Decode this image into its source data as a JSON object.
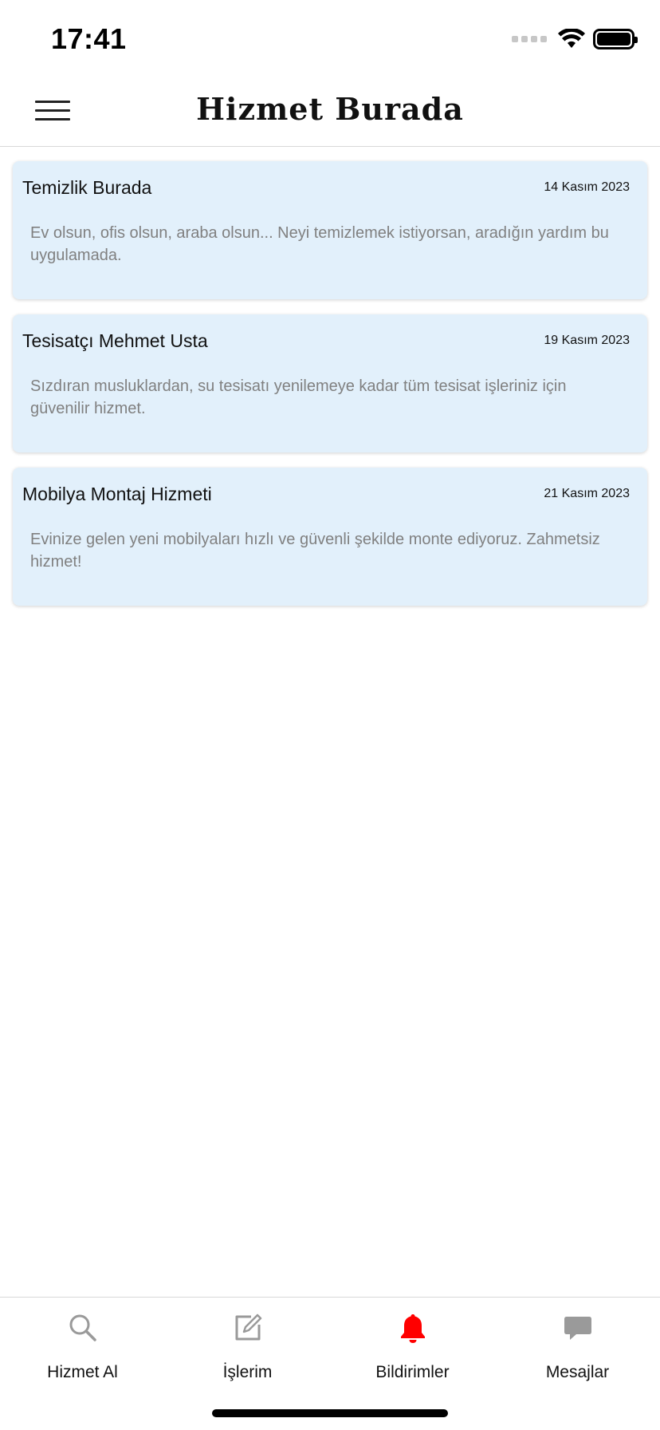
{
  "status_bar": {
    "time": "17:41"
  },
  "header": {
    "title": "Hizmet Burada",
    "menu_icon": "hamburger-menu-icon"
  },
  "cards": [
    {
      "title": "Temizlik Burada",
      "date": "14 Kasım 2023",
      "description": "Ev olsun, ofis olsun, araba olsun... Neyi temizlemek istiyorsan, aradığın yardım bu uygulamada."
    },
    {
      "title": "Tesisatçı Mehmet Usta",
      "date": "19 Kasım 2023",
      "description": "Sızdıran musluklardan, su tesisatı yenilemeye kadar tüm tesisat işleriniz için güvenilir hizmet."
    },
    {
      "title": "Mobilya Montaj Hizmeti",
      "date": "21 Kasım 2023",
      "description": "Evinize gelen yeni mobilyaları hızlı ve güvenli şekilde monte ediyoruz. Zahmetsiz hizmet!"
    }
  ],
  "tab_bar": {
    "tabs": [
      {
        "label": "Hizmet Al",
        "icon": "search-icon",
        "active": false
      },
      {
        "label": "İşlerim",
        "icon": "edit-icon",
        "active": false
      },
      {
        "label": "Bildirimler",
        "icon": "bell-icon",
        "active": true
      },
      {
        "label": "Mesajlar",
        "icon": "chat-bubble-icon",
        "active": false
      }
    ],
    "active_color": "#ff0000",
    "inactive_color": "#9a9a9a"
  },
  "colors": {
    "card_background": "#e2f0fb",
    "description_text": "#808080"
  }
}
